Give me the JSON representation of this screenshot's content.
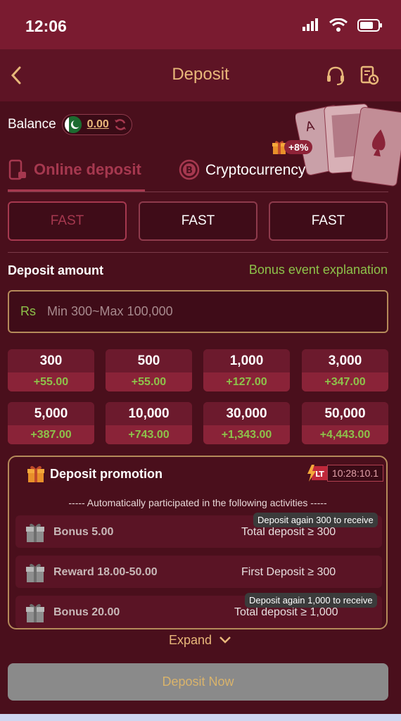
{
  "status_bar": {
    "time": "12:06"
  },
  "header": {
    "title": "Deposit"
  },
  "balance": {
    "label": "Balance",
    "value": "0.00"
  },
  "tabs": {
    "online": "Online deposit",
    "crypto": "Cryptocurrency",
    "crypto_badge": "+8%"
  },
  "channels": [
    "FAST",
    "FAST",
    "FAST"
  ],
  "deposit_amount": {
    "title": "Deposit amount",
    "bonus_link": "Bonus event explanation",
    "currency": "Rs",
    "placeholder": "Min 300~Max 100,000"
  },
  "amounts": [
    {
      "amount": "300",
      "bonus": "+55.00"
    },
    {
      "amount": "500",
      "bonus": "+55.00"
    },
    {
      "amount": "1,000",
      "bonus": "+127.00"
    },
    {
      "amount": "3,000",
      "bonus": "+347.00"
    },
    {
      "amount": "5,000",
      "bonus": "+387.00"
    },
    {
      "amount": "10,000",
      "bonus": "+743.00"
    },
    {
      "amount": "30,000",
      "bonus": "+1,343.00"
    },
    {
      "amount": "50,000",
      "bonus": "+4,443.00"
    }
  ],
  "promotion": {
    "title": "Deposit promotion",
    "lt_badge": "LT",
    "timer": "10:28:10.1",
    "note": "----- Automatically participated in the following activities -----",
    "rows": [
      {
        "name": "Bonus 5.00",
        "condition": "Total deposit ≥ 300",
        "tip": "Deposit again 300 to receive"
      },
      {
        "name": "Reward 18.00-50.00",
        "condition": "First Deposit ≥ 300",
        "tip": ""
      },
      {
        "name": "Bonus 20.00",
        "condition": "Total deposit ≥ 1,000",
        "tip": "Deposit again 1,000 to receive"
      }
    ]
  },
  "expand_label": "Expand",
  "deposit_button": "Deposit Now",
  "colors": {
    "accent": "#a6384f",
    "gold": "#e8b77a",
    "green": "#8dc24a",
    "background": "#4a0f1c"
  },
  "icons": [
    "back-icon",
    "headset-icon",
    "history-icon",
    "refresh-icon",
    "phone-icon",
    "bitcoin-icon",
    "gift-icon",
    "chevron-down-icon"
  ]
}
